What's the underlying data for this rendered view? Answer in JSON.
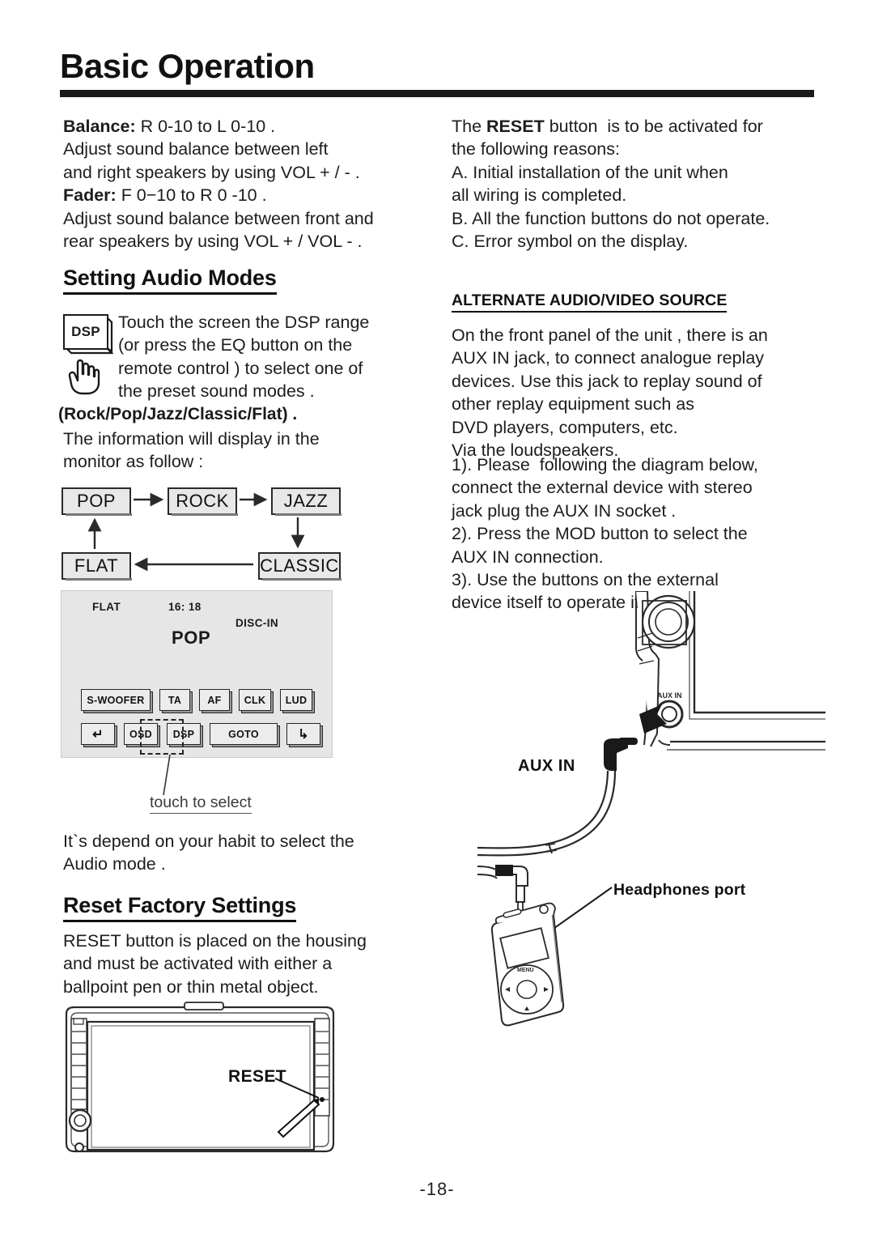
{
  "header": {
    "title": "Basic Operation"
  },
  "left_column": {
    "balance_block": {
      "balance_label": "Balance:",
      "balance_value": " R 0-10 to L 0-10 .",
      "balance_desc": "Adjust sound balance between left\nand right speakers by using VOL + / - .",
      "fader_label": "Fader:",
      "fader_value": " F 0−10 to R 0 -10 .",
      "fader_desc": "Adjust sound balance between front and\nrear speakers by using VOL + / VOL - ."
    },
    "audio_modes": {
      "heading": "Setting Audio Modes",
      "dsp_icon_label": "DSP",
      "dsp_text": "Touch the screen the DSP range\n(or press the EQ button on the\nremote control ) to select one of\nthe preset sound modes .",
      "modes_list": "(Rock/Pop/Jazz/Classic/Flat) .",
      "info_text": "The information will display in the\nmonitor as follow :"
    },
    "mode_flow": {
      "boxes": [
        "POP",
        "ROCK",
        "JAZZ",
        "CLASSIC",
        "FLAT"
      ]
    },
    "monitor": {
      "eq_label": "FLAT",
      "time": "16: 18",
      "disc_status": "DISC-IN",
      "mode": "POP",
      "row1_buttons": [
        "S-WOOFER",
        "TA",
        "AF",
        "CLK",
        "LUD"
      ],
      "row2_buttons": [
        "↵",
        "OSD",
        "DSP",
        "GOTO",
        "↳"
      ],
      "callout": "touch to select"
    },
    "habit_text": "It`s depend on your habit to select the\nAudio mode .",
    "reset_section": {
      "heading": "Reset Factory Settings",
      "text": "RESET button is placed on the housing\nand must be activated with either a\nballpoint pen or thin metal object.",
      "unit_label": "RESET"
    }
  },
  "right_column": {
    "reset_reasons": {
      "intro_pre": "The ",
      "intro_bold": "RESET",
      "intro_post": " button  is to be activated for\nthe following reasons:",
      "items": [
        "A. Initial installation of the unit when\nall wiring is completed.",
        "B. All the function buttons do not operate.",
        "C. Error symbol on the display."
      ]
    },
    "alternate_source": {
      "heading": "ALTERNATE AUDIO/VIDEO SOURCE",
      "paragraph": "On the front panel of the unit , there is an\nAUX IN jack, to connect analogue replay\ndevices. Use this jack to replay sound of\nother replay equipment such as\nDVD players, computers, etc.\nVia the loudspeakers.",
      "steps": "1). Please  following the diagram below,\nconnect the external device with stereo\njack plug the AUX IN socket .\n2). Press the MOD button to select the\nAUX IN connection.\n3). Use the buttons on the external\ndevice itself to operate it ."
    },
    "diagram": {
      "aux_in_label": "AUX IN",
      "jack_port_label": "AUX IN",
      "headphones_label": "Headphones port",
      "ipod_menu_label": "MENU"
    }
  },
  "footer": {
    "page_number": "-18-"
  },
  "colors": {
    "ink": "#1a1a1a",
    "rule": "#111111",
    "box_fill": "#e8e8e8",
    "screen_fill": "#e6e6e6"
  }
}
